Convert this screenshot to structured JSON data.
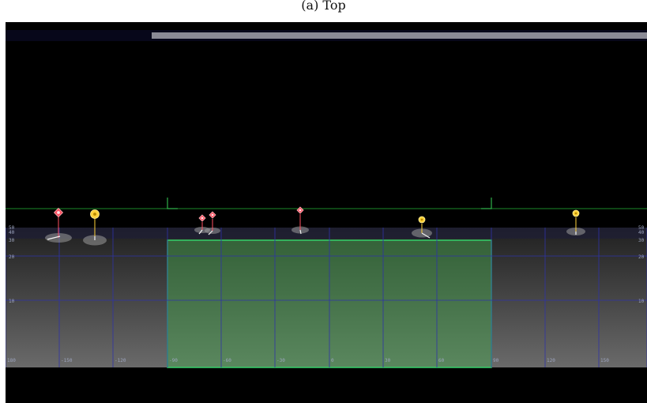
{
  "caption": "(a) Top",
  "playback": {
    "progress": 1.0,
    "colors": {
      "fill": "#8a8a95",
      "track": "#12121e"
    }
  },
  "grid": {
    "x_ticks": [
      "180",
      "-150",
      "-120",
      "-90",
      "-60",
      "-30",
      "0",
      "30",
      "60",
      "90",
      "120",
      "150",
      "180"
    ],
    "y_ticks_left": [
      "50",
      "40",
      "30",
      "20",
      "10"
    ],
    "y_ticks_right": [
      "50",
      "40",
      "30",
      "20",
      "10"
    ]
  },
  "zone": {
    "color": "#35d16a",
    "fill": "rgba(70,170,80,0.45)"
  },
  "markers": [
    {
      "kind": "red-diamond",
      "color": "#ff5060"
    },
    {
      "kind": "yellow-circle",
      "color": "#ffd23a"
    },
    {
      "kind": "red-diamond",
      "color": "#ff5060"
    },
    {
      "kind": "red-diamond",
      "color": "#ff5060"
    },
    {
      "kind": "red-diamond",
      "color": "#ff5060"
    },
    {
      "kind": "yellow-circle",
      "color": "#ffd23a"
    },
    {
      "kind": "yellow-circle",
      "color": "#ffd23a"
    }
  ],
  "colors": {
    "background": "#000000",
    "grid_line": "#2f33a8",
    "horizon_line": "#1d8a2a",
    "floor_top": "#222222",
    "floor_bottom": "#6a6a6a"
  }
}
